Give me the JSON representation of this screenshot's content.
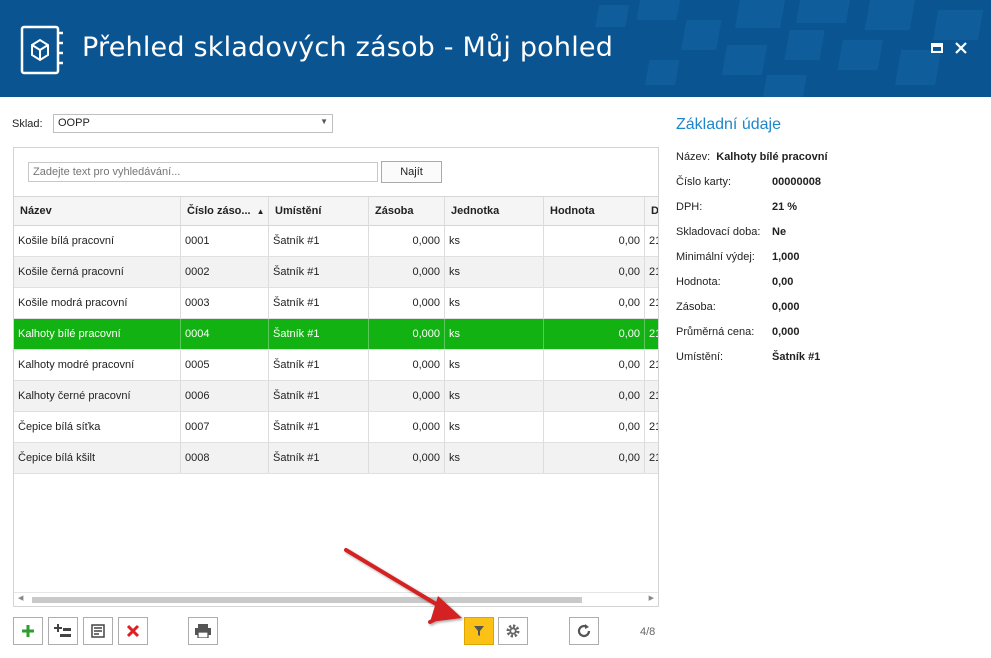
{
  "window": {
    "title": "Přehled skladových zásob - Můj pohled",
    "app_icon": "box-book-icon",
    "maximize_icon": "maximize-icon",
    "close_icon": "close-icon"
  },
  "filter": {
    "sklad_label": "Sklad:",
    "sklad_value": "OOPP"
  },
  "search": {
    "placeholder": "Zadejte text pro vyhledávání...",
    "button_label": "Najít"
  },
  "table": {
    "columns": [
      "Název",
      "Číslo záso...",
      "Umístění",
      "Zásoba",
      "Jednotka",
      "Hodnota",
      "D"
    ],
    "sort_indicator": "▲",
    "rows": [
      {
        "nazev": "Košile bílá pracovní",
        "cislo": "0001",
        "umisteni": "Šatník #1",
        "zasoba": "0,000",
        "jednotka": "ks",
        "hodnota": "0,00",
        "d": "21"
      },
      {
        "nazev": "Košile černá pracovní",
        "cislo": "0002",
        "umisteni": "Šatník #1",
        "zasoba": "0,000",
        "jednotka": "ks",
        "hodnota": "0,00",
        "d": "21"
      },
      {
        "nazev": "Košile modrá pracovní",
        "cislo": "0003",
        "umisteni": "Šatník #1",
        "zasoba": "0,000",
        "jednotka": "ks",
        "hodnota": "0,00",
        "d": "21"
      },
      {
        "nazev": "Kalhoty bílé pracovní",
        "cislo": "0004",
        "umisteni": "Šatník #1",
        "zasoba": "0,000",
        "jednotka": "ks",
        "hodnota": "0,00",
        "d": "21"
      },
      {
        "nazev": "Kalhoty modré pracovní",
        "cislo": "0005",
        "umisteni": "Šatník #1",
        "zasoba": "0,000",
        "jednotka": "ks",
        "hodnota": "0,00",
        "d": "21"
      },
      {
        "nazev": "Kalhoty černé pracovní",
        "cislo": "0006",
        "umisteni": "Šatník #1",
        "zasoba": "0,000",
        "jednotka": "ks",
        "hodnota": "0,00",
        "d": "21"
      },
      {
        "nazev": "Čepice bílá síťka",
        "cislo": "0007",
        "umisteni": "Šatník #1",
        "zasoba": "0,000",
        "jednotka": "ks",
        "hodnota": "0,00",
        "d": "21"
      },
      {
        "nazev": "Čepice bílá kšilt",
        "cislo": "0008",
        "umisteni": "Šatník #1",
        "zasoba": "0,000",
        "jednotka": "ks",
        "hodnota": "0,00",
        "d": "21"
      }
    ],
    "selected_row": "Kalhoty bílé pracovní"
  },
  "toolbar": {
    "buttons": [
      "add-icon",
      "add-sub-icon",
      "edit-icon",
      "delete-icon",
      "print-icon",
      "filter-icon",
      "settings-icon",
      "refresh-icon"
    ],
    "pager": "4/8"
  },
  "details": {
    "title": "Základní údaje",
    "nazev_label": "Název:",
    "nazev_value": "Kalhoty bílé pracovní",
    "fields": [
      {
        "label": "Číslo karty:",
        "value": "00000008"
      },
      {
        "label": "DPH:",
        "value": "21 %"
      },
      {
        "label": "Skladovací doba:",
        "value": "Ne"
      },
      {
        "label": "Minimální výdej:",
        "value": "1,000"
      },
      {
        "label": "Hodnota:",
        "value": "0,00"
      },
      {
        "label": "Zásoba:",
        "value": "0,000"
      },
      {
        "label": "Průměrná cena:",
        "value": "0,000"
      },
      {
        "label": "Umístění:",
        "value": "Šatník #1"
      }
    ]
  },
  "colors": {
    "header_bg": "#0a5491",
    "selected_row": "#11b211",
    "accent_title": "#1e87c9",
    "active_button": "#fbc115",
    "annotation_arrow": "#d42020"
  }
}
